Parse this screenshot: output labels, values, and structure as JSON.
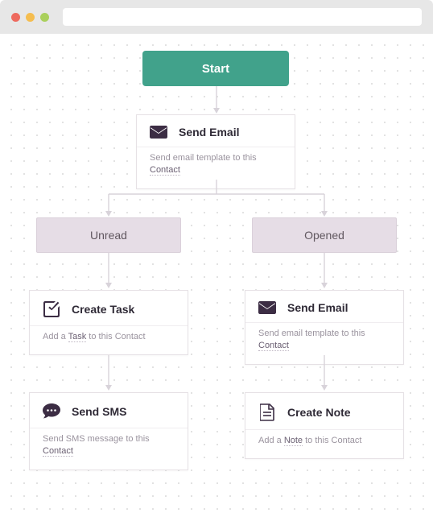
{
  "start": {
    "label": "Start"
  },
  "email1": {
    "title": "Send Email",
    "sub_prefix": "Send email template to this ",
    "sub_link": "Contact"
  },
  "branches": {
    "unread": "Unread",
    "opened": "Opened"
  },
  "createTask": {
    "title": "Create Task",
    "sub_prefix": "Add a ",
    "sub_link1": "Task",
    "sub_mid": " to this Contact"
  },
  "email2": {
    "title": "Send Email",
    "sub_prefix": "Send email template to this ",
    "sub_link": "Contact"
  },
  "sms": {
    "title": "Send SMS",
    "sub_prefix": "Send SMS message to this ",
    "sub_link": "Contact"
  },
  "note": {
    "title": "Create Note",
    "sub_prefix": "Add a ",
    "sub_link1": "Note",
    "sub_mid": " to this Contact"
  }
}
